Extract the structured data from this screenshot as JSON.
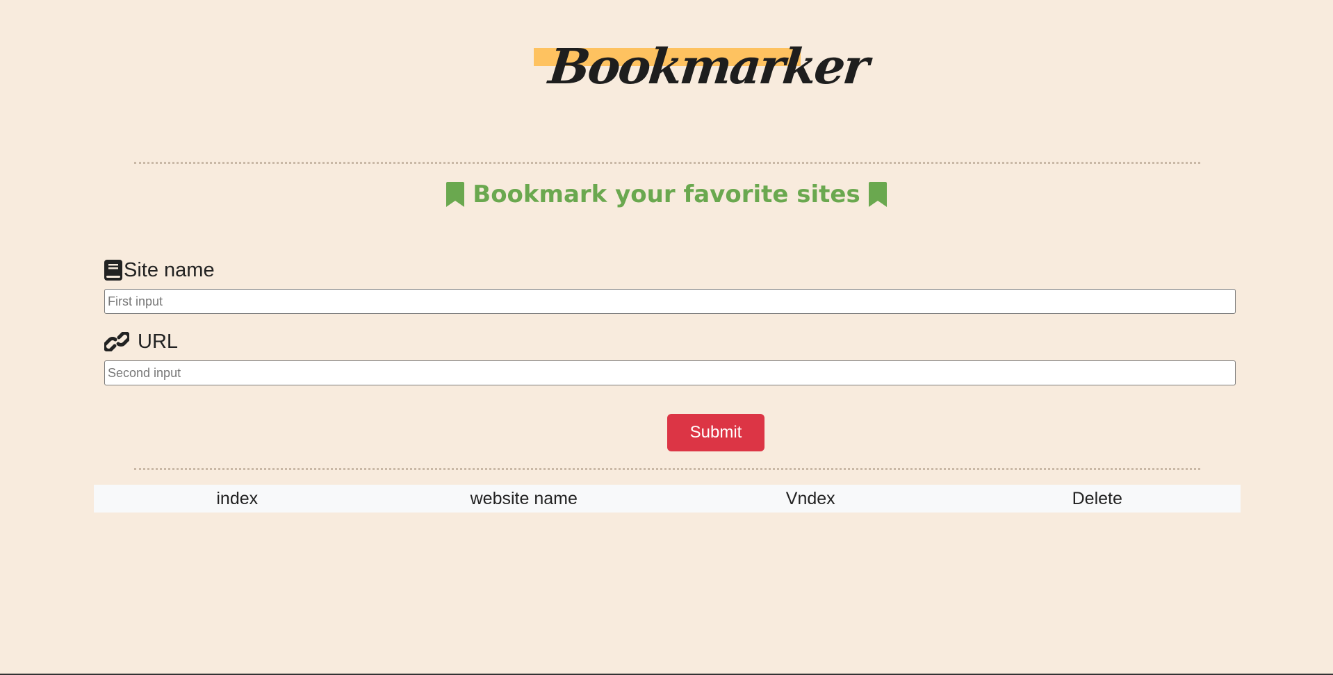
{
  "brand": {
    "title": "Bookmarker"
  },
  "tagline": {
    "text": "Bookmark your favorite sites",
    "icon": "bookmark-icon",
    "color": "#6aa84f"
  },
  "form": {
    "site_name": {
      "label": "Site name",
      "icon": "book-icon",
      "placeholder": "First input",
      "value": ""
    },
    "url": {
      "label": "URL",
      "icon": "link-icon",
      "placeholder": "Second input",
      "value": ""
    },
    "submit_label": "Submit",
    "submit_color": "#dc3545"
  },
  "table": {
    "headers": [
      "index",
      "website name",
      "Vndex",
      "Delete"
    ],
    "rows": []
  },
  "colors": {
    "background": "#f8ebdd",
    "brand_highlight": "#fec260"
  }
}
